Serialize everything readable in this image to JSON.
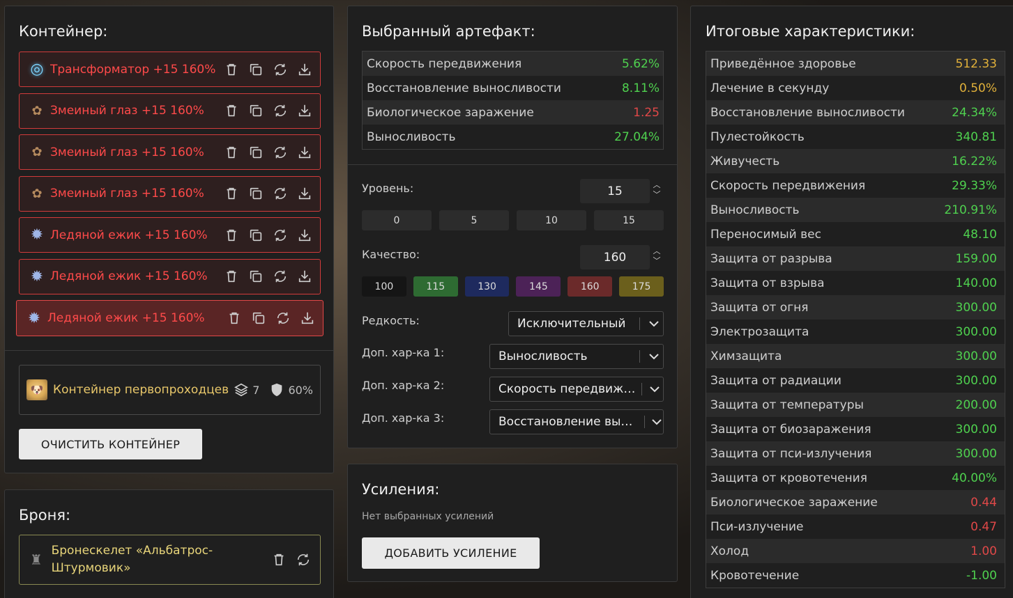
{
  "container": {
    "title": "Контейнер:",
    "artifacts": [
      {
        "icon": "ring-icon",
        "glyph": "◎",
        "name": "Трансформатор +15 160%"
      },
      {
        "icon": "eye-icon",
        "glyph": "✿",
        "name": "Змеиный глаз +15 160%"
      },
      {
        "icon": "eye-icon",
        "glyph": "✿",
        "name": "Змеиный глаз +15 160%"
      },
      {
        "icon": "eye-icon",
        "glyph": "✿",
        "name": "Змеиный глаз +15 160%"
      },
      {
        "icon": "hedgehog-icon",
        "glyph": "✹",
        "name": "Ледяной ежик +15 160%"
      },
      {
        "icon": "hedgehog-icon",
        "glyph": "✹",
        "name": "Ледяной ежик +15 160%"
      },
      {
        "icon": "hedgehog-icon",
        "glyph": "✹",
        "name": "Ледяной ежик +15 160%"
      }
    ],
    "card": {
      "name": "Контейнер первопроходцев",
      "slots": "7",
      "protection": "60%"
    },
    "clear_label": "ОЧИСТИТЬ КОНТЕЙНЕР"
  },
  "armor": {
    "title": "Броня:",
    "name": "Бронескелет «Альбатрос-Штурмовик»"
  },
  "artifact": {
    "title": "Выбранный артефакт:",
    "stats": [
      {
        "label": "Скорость передвижения",
        "value": "5.62%",
        "color": "green"
      },
      {
        "label": "Восстановление выносливости",
        "value": "8.11%",
        "color": "green"
      },
      {
        "label": "Биологическое заражение",
        "value": "1.25",
        "color": "red"
      },
      {
        "label": "Выносливость",
        "value": "27.04%",
        "color": "green"
      }
    ],
    "level_label": "Уровень:",
    "level_value": "15",
    "level_presets": [
      "0",
      "5",
      "10",
      "15"
    ],
    "quality_label": "Качество:",
    "quality_value": "160",
    "quality_presets": [
      {
        "label": "100",
        "color": "#151515"
      },
      {
        "label": "115",
        "color": "#2e6b32"
      },
      {
        "label": "130",
        "color": "#1e2a5e"
      },
      {
        "label": "145",
        "color": "#4c2257"
      },
      {
        "label": "160",
        "color": "#6b2a2a"
      },
      {
        "label": "175",
        "color": "#6b5f1c"
      }
    ],
    "rarity_label": "Редкость:",
    "rarity_value": "Исключительный",
    "extra1_label": "Доп. хар-ка 1:",
    "extra1_value": "Выносливость",
    "extra2_label": "Доп. хар-ка 2:",
    "extra2_value": "Скорость передвижения",
    "extra3_label": "Доп. хар-ка 3:",
    "extra3_value": "Восстановление выносливости"
  },
  "boosts": {
    "title": "Усиления:",
    "empty": "Нет выбранных усилений",
    "add_label": "ДОБАВИТЬ УСИЛЕНИЕ"
  },
  "totals": {
    "title": "Итоговые характеристики:",
    "stats": [
      {
        "label": "Приведённое здоровье",
        "value": "512.33",
        "color": "yellow"
      },
      {
        "label": "Лечение в секунду",
        "value": "0.50%",
        "color": "yellow"
      },
      {
        "label": "Восстановление выносливости",
        "value": "24.34%",
        "color": "green"
      },
      {
        "label": "Пулестойкость",
        "value": "340.81",
        "color": "green"
      },
      {
        "label": "Живучесть",
        "value": "16.22%",
        "color": "green"
      },
      {
        "label": "Скорость передвижения",
        "value": "29.33%",
        "color": "green"
      },
      {
        "label": "Выносливость",
        "value": "210.91%",
        "color": "green"
      },
      {
        "label": "Переносимый вес",
        "value": "48.10",
        "color": "green"
      },
      {
        "label": "Защита от разрыва",
        "value": "159.00",
        "color": "green"
      },
      {
        "label": "Защита от взрыва",
        "value": "140.00",
        "color": "green"
      },
      {
        "label": "Защита от огня",
        "value": "300.00",
        "color": "green"
      },
      {
        "label": "Электрозащита",
        "value": "300.00",
        "color": "green"
      },
      {
        "label": "Химзащита",
        "value": "300.00",
        "color": "green"
      },
      {
        "label": "Защита от радиации",
        "value": "300.00",
        "color": "green"
      },
      {
        "label": "Защита от температуры",
        "value": "200.00",
        "color": "green"
      },
      {
        "label": "Защита от биозаражения",
        "value": "300.00",
        "color": "green"
      },
      {
        "label": "Защита от пси-излучения",
        "value": "300.00",
        "color": "green"
      },
      {
        "label": "Защита от кровотечения",
        "value": "40.00%",
        "color": "green"
      },
      {
        "label": "Биологическое заражение",
        "value": "0.44",
        "color": "red"
      },
      {
        "label": "Пси-излучение",
        "value": "0.47",
        "color": "red"
      },
      {
        "label": "Холод",
        "value": "1.00",
        "color": "red"
      },
      {
        "label": "Кровотечение",
        "value": "-1.00",
        "color": "green"
      }
    ]
  }
}
